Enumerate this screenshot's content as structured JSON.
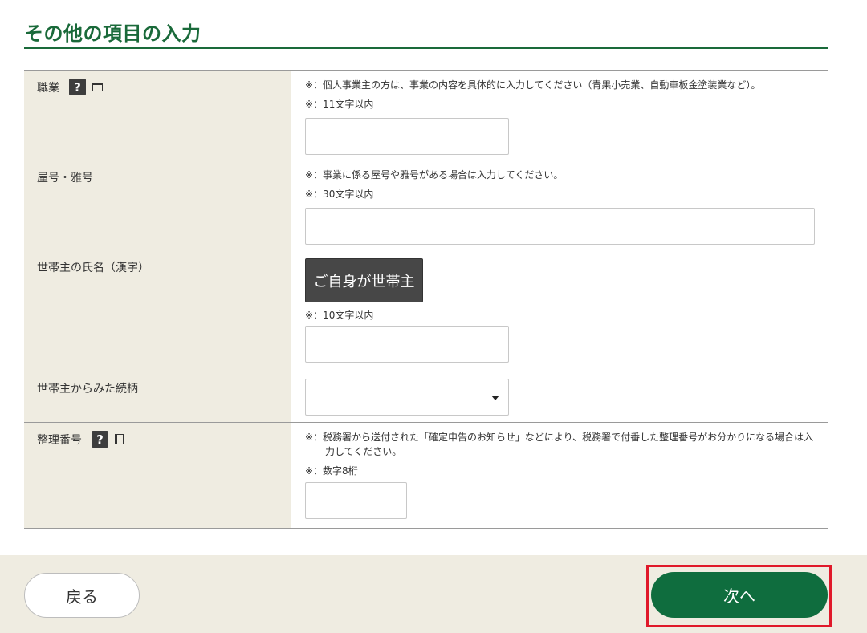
{
  "section": {
    "title": "その他の項目の入力"
  },
  "rows": {
    "occupation": {
      "label": "職業",
      "help_icon": "?",
      "note1": "※：個人事業主の方は、事業の内容を具体的に入力してください（青果小売業、自動車板金塗装業など）。",
      "note2": "※：11文字以内",
      "value": ""
    },
    "trade_name": {
      "label": "屋号・雅号",
      "note1": "※：事業に係る屋号や雅号がある場合は入力してください。",
      "note2": "※：30文字以内",
      "value": ""
    },
    "householder": {
      "label": "世帯主の氏名（漢字）",
      "self_button": "ご自身が世帯主",
      "note": "※：10文字以内",
      "value": ""
    },
    "relationship": {
      "label": "世帯主からみた続柄",
      "selected": ""
    },
    "reference_number": {
      "label": "整理番号",
      "help_icon": "?",
      "note1": "※：税務署から送付された「確定申告のお知らせ」などにより、税務署で付番した整理番号がお分かりになる場合は入力してください。",
      "note2": "※：数字8桁",
      "value": ""
    }
  },
  "footer": {
    "back_label": "戻る",
    "next_label": "次へ",
    "highlight_color": "#e0192a",
    "next_color": "#0f6d3e"
  },
  "icons": {
    "help": "question-mark-icon",
    "window": "window-icon",
    "book": "book-icon",
    "select": "triangle-down-icon"
  }
}
